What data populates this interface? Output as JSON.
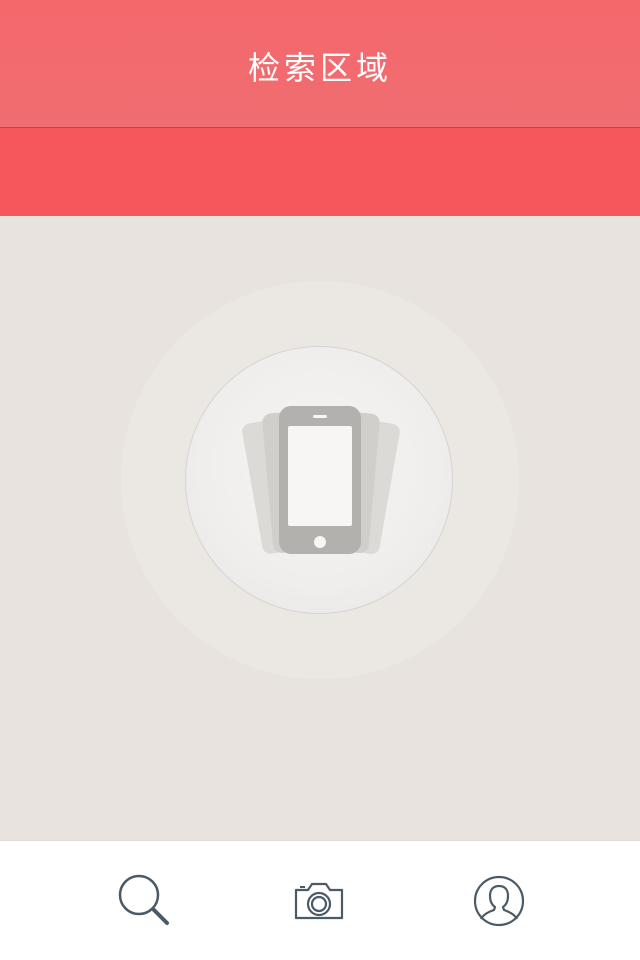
{
  "header": {
    "title": "检索区域"
  },
  "colors": {
    "title_bar": "#f36a6d",
    "search_band": "#f6575c",
    "content_bg": "#e8e3df",
    "tab_icon": "#4a5a66"
  },
  "center_illustration": {
    "icon": "rotating-phone-icon"
  },
  "tab_bar": {
    "tabs": [
      {
        "icon": "search-icon"
      },
      {
        "icon": "camera-icon"
      },
      {
        "icon": "user-profile-icon"
      }
    ]
  }
}
